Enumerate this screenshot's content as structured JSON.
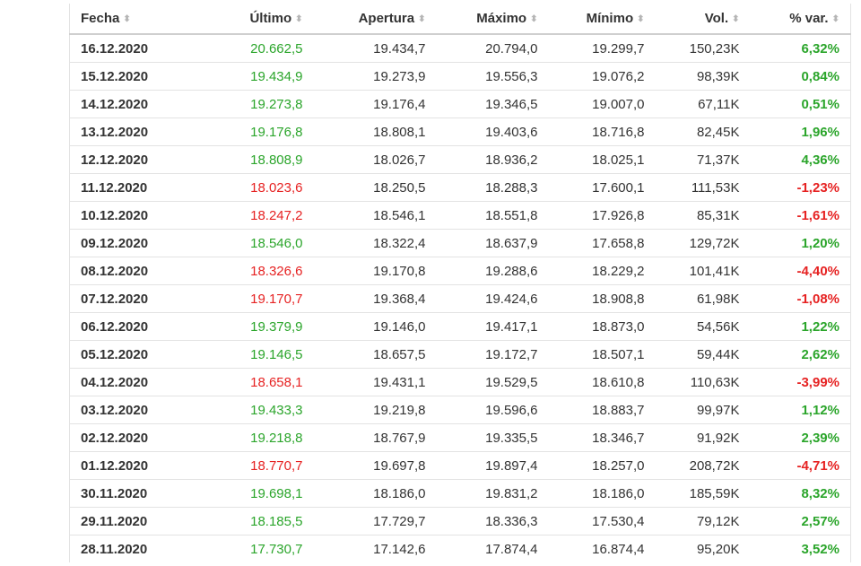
{
  "columns": [
    {
      "label": "Fecha",
      "align": "left"
    },
    {
      "label": "Último",
      "align": "right"
    },
    {
      "label": "Apertura",
      "align": "right"
    },
    {
      "label": "Máximo",
      "align": "right"
    },
    {
      "label": "Mínimo",
      "align": "right"
    },
    {
      "label": "Vol.",
      "align": "right"
    },
    {
      "label": "% var.",
      "align": "right"
    }
  ],
  "sort_icon": "sort-updown-icon",
  "colors": {
    "positive": "#2ba52b",
    "negative": "#e62222",
    "text": "#333333"
  },
  "rows": [
    {
      "fecha": "16.12.2020",
      "ultimo": "20.662,5",
      "apertura": "19.434,7",
      "maximo": "20.794,0",
      "minimo": "19.299,7",
      "vol": "150,23K",
      "var": "6,32%",
      "dir": "up"
    },
    {
      "fecha": "15.12.2020",
      "ultimo": "19.434,9",
      "apertura": "19.273,9",
      "maximo": "19.556,3",
      "minimo": "19.076,2",
      "vol": "98,39K",
      "var": "0,84%",
      "dir": "up"
    },
    {
      "fecha": "14.12.2020",
      "ultimo": "19.273,8",
      "apertura": "19.176,4",
      "maximo": "19.346,5",
      "minimo": "19.007,0",
      "vol": "67,11K",
      "var": "0,51%",
      "dir": "up"
    },
    {
      "fecha": "13.12.2020",
      "ultimo": "19.176,8",
      "apertura": "18.808,1",
      "maximo": "19.403,6",
      "minimo": "18.716,8",
      "vol": "82,45K",
      "var": "1,96%",
      "dir": "up"
    },
    {
      "fecha": "12.12.2020",
      "ultimo": "18.808,9",
      "apertura": "18.026,7",
      "maximo": "18.936,2",
      "minimo": "18.025,1",
      "vol": "71,37K",
      "var": "4,36%",
      "dir": "up"
    },
    {
      "fecha": "11.12.2020",
      "ultimo": "18.023,6",
      "apertura": "18.250,5",
      "maximo": "18.288,3",
      "minimo": "17.600,1",
      "vol": "111,53K",
      "var": "-1,23%",
      "dir": "down"
    },
    {
      "fecha": "10.12.2020",
      "ultimo": "18.247,2",
      "apertura": "18.546,1",
      "maximo": "18.551,8",
      "minimo": "17.926,8",
      "vol": "85,31K",
      "var": "-1,61%",
      "dir": "down"
    },
    {
      "fecha": "09.12.2020",
      "ultimo": "18.546,0",
      "apertura": "18.322,4",
      "maximo": "18.637,9",
      "minimo": "17.658,8",
      "vol": "129,72K",
      "var": "1,20%",
      "dir": "up"
    },
    {
      "fecha": "08.12.2020",
      "ultimo": "18.326,6",
      "apertura": "19.170,8",
      "maximo": "19.288,6",
      "minimo": "18.229,2",
      "vol": "101,41K",
      "var": "-4,40%",
      "dir": "down"
    },
    {
      "fecha": "07.12.2020",
      "ultimo": "19.170,7",
      "apertura": "19.368,4",
      "maximo": "19.424,6",
      "minimo": "18.908,8",
      "vol": "61,98K",
      "var": "-1,08%",
      "dir": "down"
    },
    {
      "fecha": "06.12.2020",
      "ultimo": "19.379,9",
      "apertura": "19.146,0",
      "maximo": "19.417,1",
      "minimo": "18.873,0",
      "vol": "54,56K",
      "var": "1,22%",
      "dir": "up"
    },
    {
      "fecha": "05.12.2020",
      "ultimo": "19.146,5",
      "apertura": "18.657,5",
      "maximo": "19.172,7",
      "minimo": "18.507,1",
      "vol": "59,44K",
      "var": "2,62%",
      "dir": "up"
    },
    {
      "fecha": "04.12.2020",
      "ultimo": "18.658,1",
      "apertura": "19.431,1",
      "maximo": "19.529,5",
      "minimo": "18.610,8",
      "vol": "110,63K",
      "var": "-3,99%",
      "dir": "down"
    },
    {
      "fecha": "03.12.2020",
      "ultimo": "19.433,3",
      "apertura": "19.219,8",
      "maximo": "19.596,6",
      "minimo": "18.883,7",
      "vol": "99,97K",
      "var": "1,12%",
      "dir": "up"
    },
    {
      "fecha": "02.12.2020",
      "ultimo": "19.218,8",
      "apertura": "18.767,9",
      "maximo": "19.335,5",
      "minimo": "18.346,7",
      "vol": "91,92K",
      "var": "2,39%",
      "dir": "up"
    },
    {
      "fecha": "01.12.2020",
      "ultimo": "18.770,7",
      "apertura": "19.697,8",
      "maximo": "19.897,4",
      "minimo": "18.257,0",
      "vol": "208,72K",
      "var": "-4,71%",
      "dir": "down"
    },
    {
      "fecha": "30.11.2020",
      "ultimo": "19.698,1",
      "apertura": "18.186,0",
      "maximo": "19.831,2",
      "minimo": "18.186,0",
      "vol": "185,59K",
      "var": "8,32%",
      "dir": "up"
    },
    {
      "fecha": "29.11.2020",
      "ultimo": "18.185,5",
      "apertura": "17.729,7",
      "maximo": "18.336,3",
      "minimo": "17.530,4",
      "vol": "79,12K",
      "var": "2,57%",
      "dir": "up"
    },
    {
      "fecha": "28.11.2020",
      "ultimo": "17.730,7",
      "apertura": "17.142,6",
      "maximo": "17.874,4",
      "minimo": "16.874,4",
      "vol": "95,20K",
      "var": "3,52%",
      "dir": "up"
    }
  ]
}
